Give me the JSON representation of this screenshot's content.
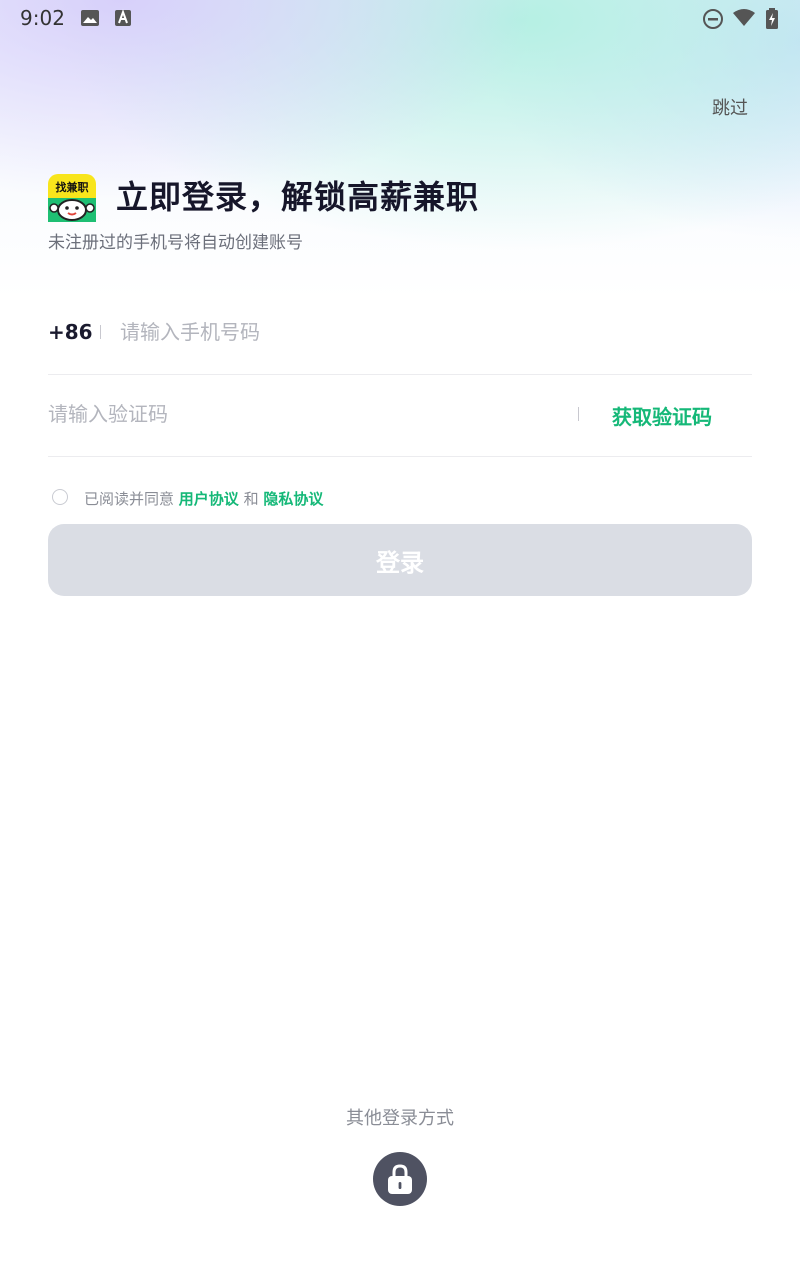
{
  "status_bar": {
    "time": "9:02",
    "icons": [
      "image-icon",
      "font-icon",
      "do-not-disturb-icon",
      "wifi-icon",
      "battery-charging-icon"
    ]
  },
  "header": {
    "skip_label": "跳过",
    "title": "立即登录，解锁高薪兼职",
    "subtitle": "未注册过的手机号将自动创建账号",
    "logo_text": "找兼职"
  },
  "form": {
    "country_code": "+86",
    "phone_placeholder": "请输入手机号码",
    "code_placeholder": "请输入验证码",
    "get_code_label": "获取验证码"
  },
  "agreement": {
    "prefix": "已阅读并同意",
    "user_agreement": "用户协议",
    "and": "和",
    "privacy_agreement": "隐私协议"
  },
  "login_button": "登录",
  "other_login": {
    "label": "其他登录方式",
    "icon": "lock-icon"
  },
  "colors": {
    "accent": "#15b878",
    "button_disabled": "#dadde4",
    "lock_bg": "#4f5262"
  }
}
